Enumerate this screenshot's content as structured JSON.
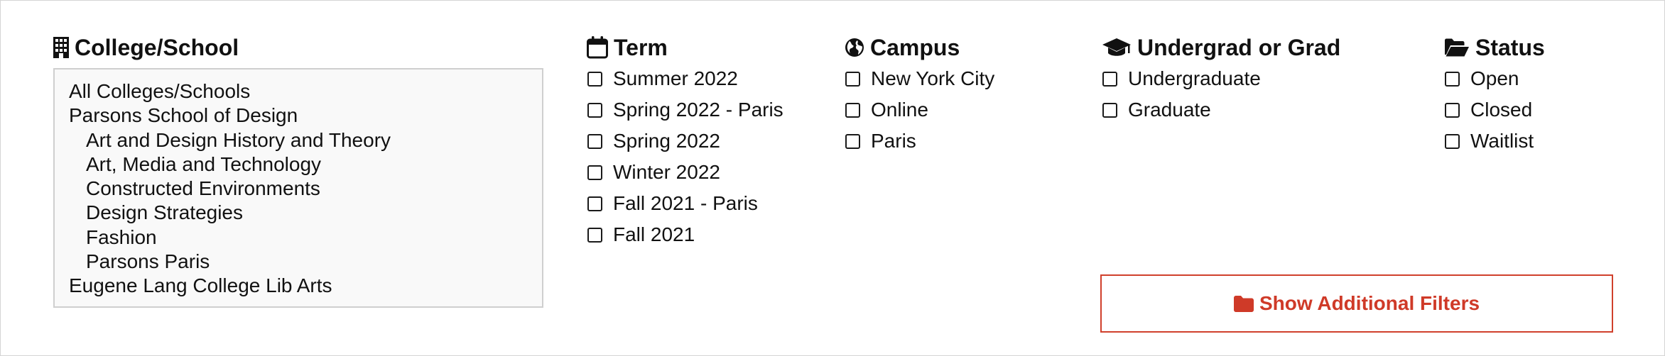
{
  "college": {
    "heading": "College/School",
    "icon": "building-icon",
    "options": [
      {
        "label": "All Colleges/Schools",
        "child": false
      },
      {
        "label": "Parsons School of Design",
        "child": false
      },
      {
        "label": "Art and Design History and Theory",
        "child": true
      },
      {
        "label": "Art, Media and Technology",
        "child": true
      },
      {
        "label": "Constructed Environments",
        "child": true
      },
      {
        "label": "Design Strategies",
        "child": true
      },
      {
        "label": "Fashion",
        "child": true
      },
      {
        "label": "Parsons Paris",
        "child": true
      },
      {
        "label": "Eugene Lang College Lib Arts",
        "child": false
      }
    ]
  },
  "term": {
    "heading": "Term",
    "icon": "calendar-icon",
    "options": [
      "Summer 2022",
      "Spring 2022 - Paris",
      "Spring 2022",
      "Winter 2022",
      "Fall 2021 - Paris",
      "Fall 2021"
    ]
  },
  "campus": {
    "heading": "Campus",
    "icon": "globe-icon",
    "options": [
      "New York City",
      "Online",
      "Paris"
    ]
  },
  "level": {
    "heading": "Undergrad or Grad",
    "icon": "graduation-cap-icon",
    "options": [
      "Undergraduate",
      "Graduate"
    ]
  },
  "status": {
    "heading": "Status",
    "icon": "folder-open-icon",
    "options": [
      "Open",
      "Closed",
      "Waitlist"
    ]
  },
  "more_filters": {
    "label": "Show Additional Filters",
    "icon": "folder-icon"
  },
  "colors": {
    "accent": "#cf3a28",
    "text": "#111111",
    "listbox_bg": "#f9f9f9",
    "border": "#cfcfcf"
  }
}
